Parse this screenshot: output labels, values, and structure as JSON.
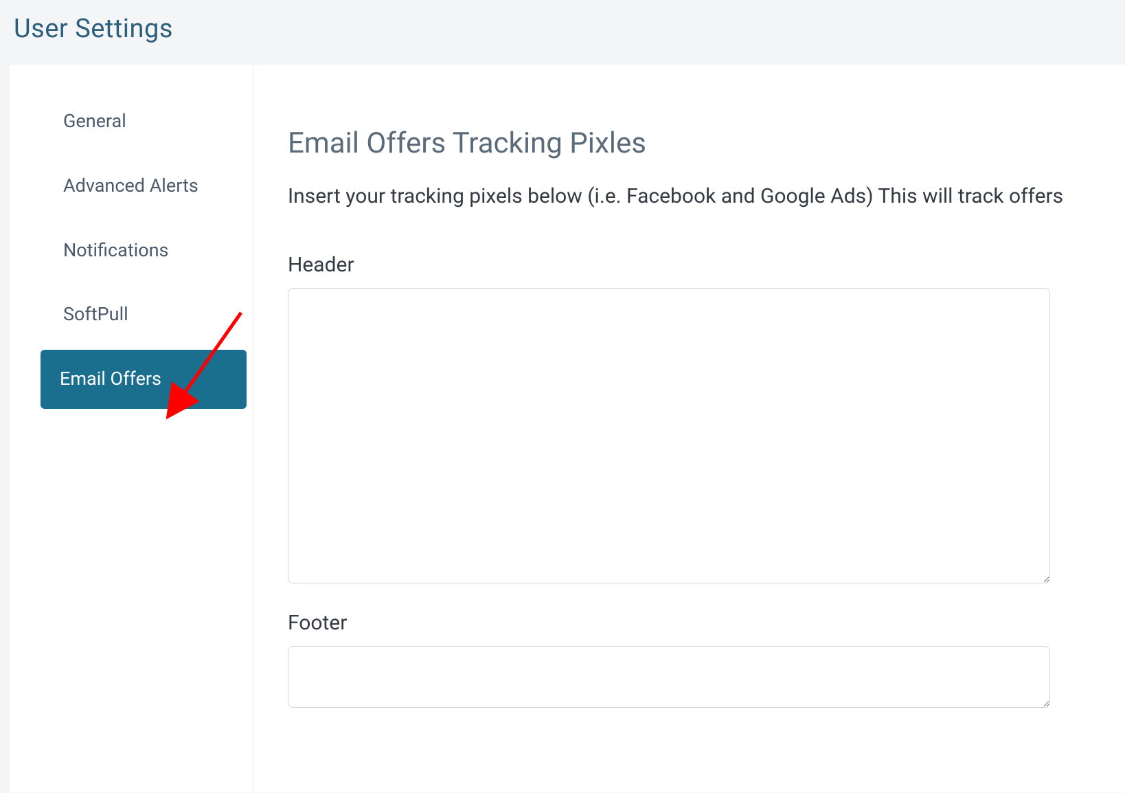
{
  "page": {
    "title": "User Settings"
  },
  "sidebar": {
    "items": [
      {
        "label": "General",
        "active": false
      },
      {
        "label": "Advanced Alerts",
        "active": false
      },
      {
        "label": "Notifications",
        "active": false
      },
      {
        "label": "SoftPull",
        "active": false
      },
      {
        "label": "Email Offers",
        "active": true
      }
    ]
  },
  "main": {
    "heading": "Email Offers Tracking Pixles",
    "description": "Insert your tracking pixels below (i.e. Facebook and Google Ads) This will track offers",
    "fields": {
      "header": {
        "label": "Header",
        "value": ""
      },
      "footer": {
        "label": "Footer",
        "value": ""
      }
    }
  },
  "annotation": {
    "arrow_color": "#ff0000"
  }
}
